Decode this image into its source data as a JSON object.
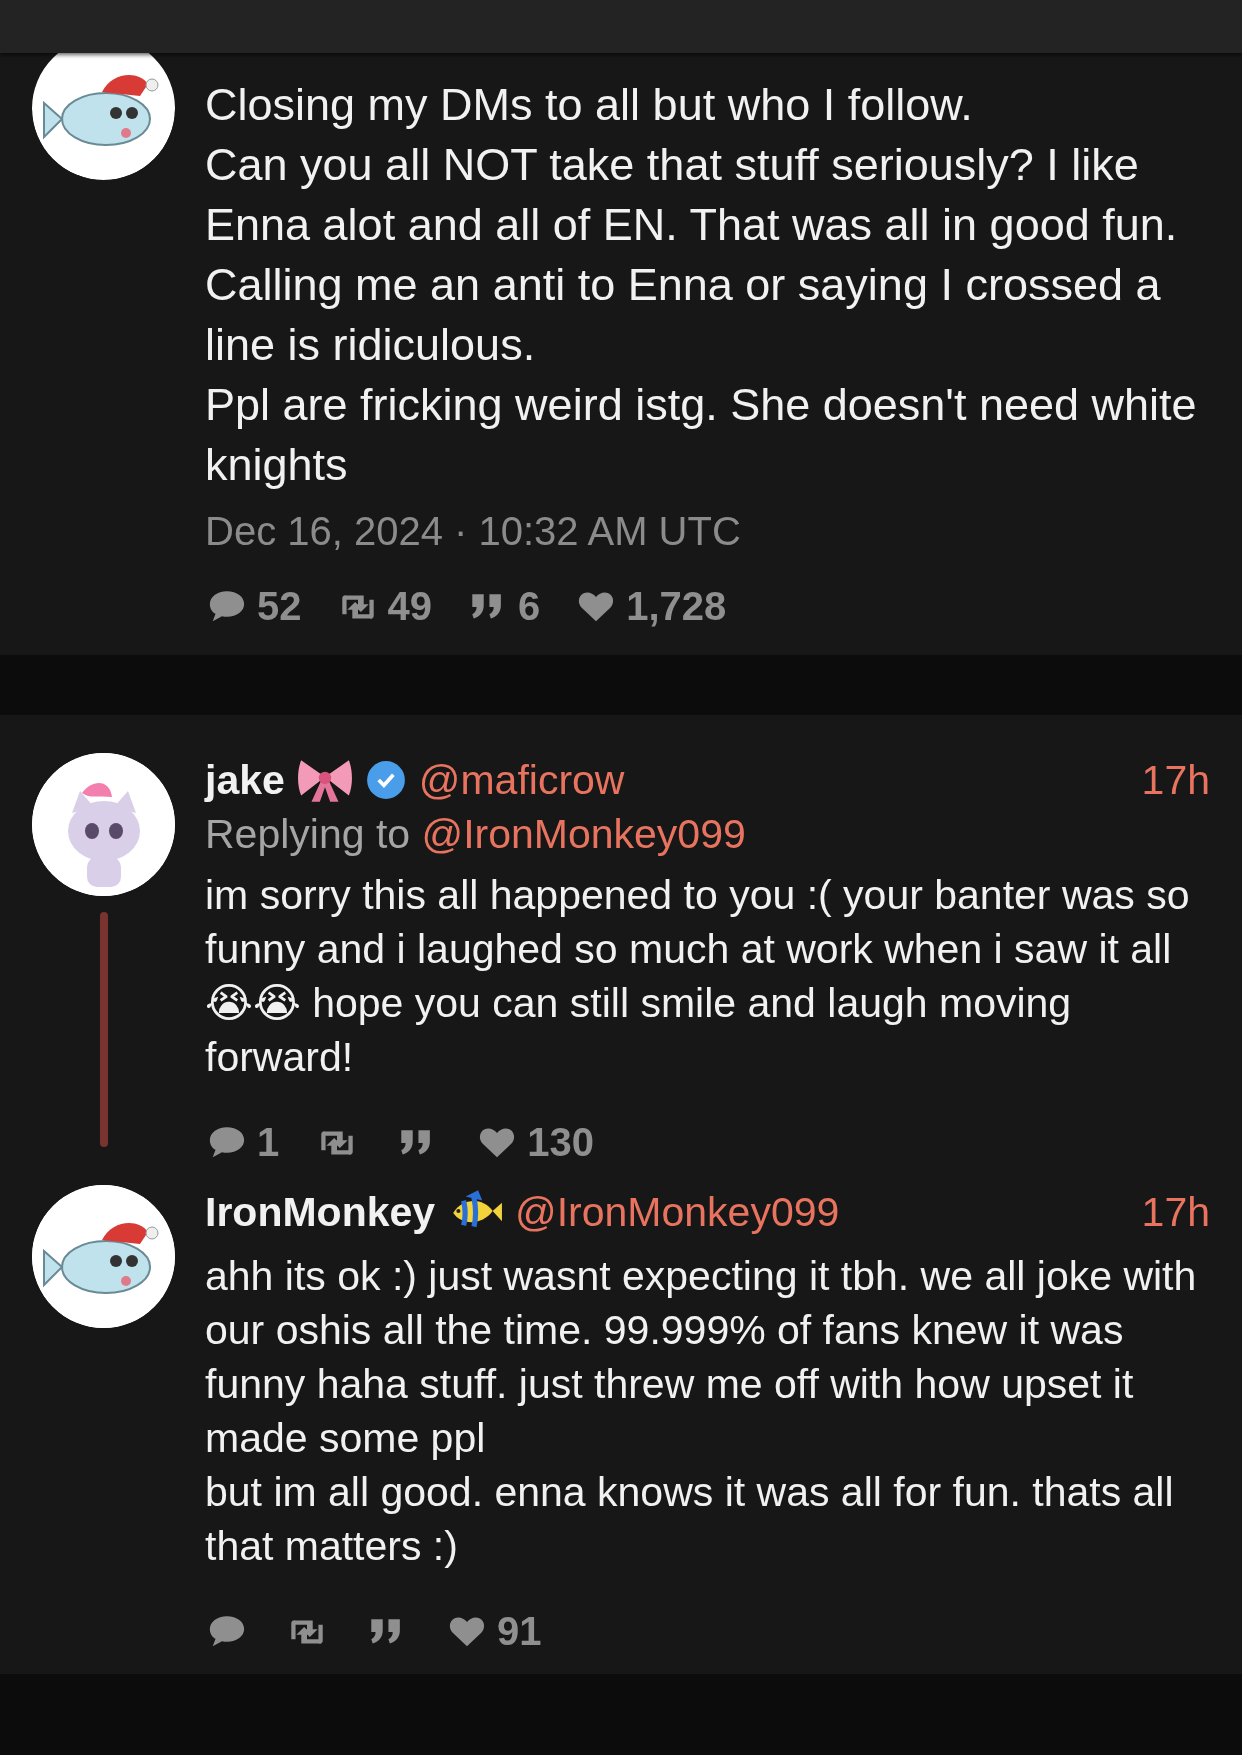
{
  "main_post": {
    "paragraphs": [
      "Closing my DMs to all but who I follow.",
      "Can you all NOT take that stuff seriously? I like Enna alot and all of EN. That was all in good fun. Calling me an anti to Enna or saying I crossed a line is ridiculous.",
      "Ppl are fricking weird istg. She doesn't need white knights"
    ],
    "timestamp": "Dec 16, 2024 · 10:32 AM UTC",
    "stats": [
      {
        "kind": "reply",
        "count": "52"
      },
      {
        "kind": "retweet",
        "count": "49"
      },
      {
        "kind": "quote",
        "count": "6"
      },
      {
        "kind": "like",
        "count": "1,728"
      }
    ]
  },
  "replies": [
    {
      "author": {
        "name": "jake",
        "verified": true,
        "handle": "@maficrow"
      },
      "time": "17h",
      "replying_label": "Replying to",
      "replying_to": "@IronMonkey099",
      "thread_line": true,
      "paragraphs": [
        "im sorry this all happened to you :( your banter was so funny and i laughed so much at work when i saw it all 😭😭 hope you can still smile and laugh moving forward!"
      ],
      "stats": [
        {
          "kind": "reply",
          "count": "1"
        },
        {
          "kind": "retweet"
        },
        {
          "kind": "quote"
        },
        {
          "kind": "like",
          "count": "130"
        }
      ]
    },
    {
      "author": {
        "name": "IronMonkey",
        "verified": false,
        "handle": "@IronMonkey099"
      },
      "time": "17h",
      "thread_line": false,
      "paragraphs": [
        "ahh its ok :) just wasnt expecting it tbh. we all joke with our oshis all the time. 99.999% of fans knew it was funny haha stuff. just threw me off with how upset it made some ppl",
        "but im all good. enna knows it was all for fun. thats all that matters :)"
      ],
      "stats": [
        {
          "kind": "reply"
        },
        {
          "kind": "retweet"
        },
        {
          "kind": "quote"
        },
        {
          "kind": "like",
          "count": "91"
        }
      ]
    }
  ]
}
